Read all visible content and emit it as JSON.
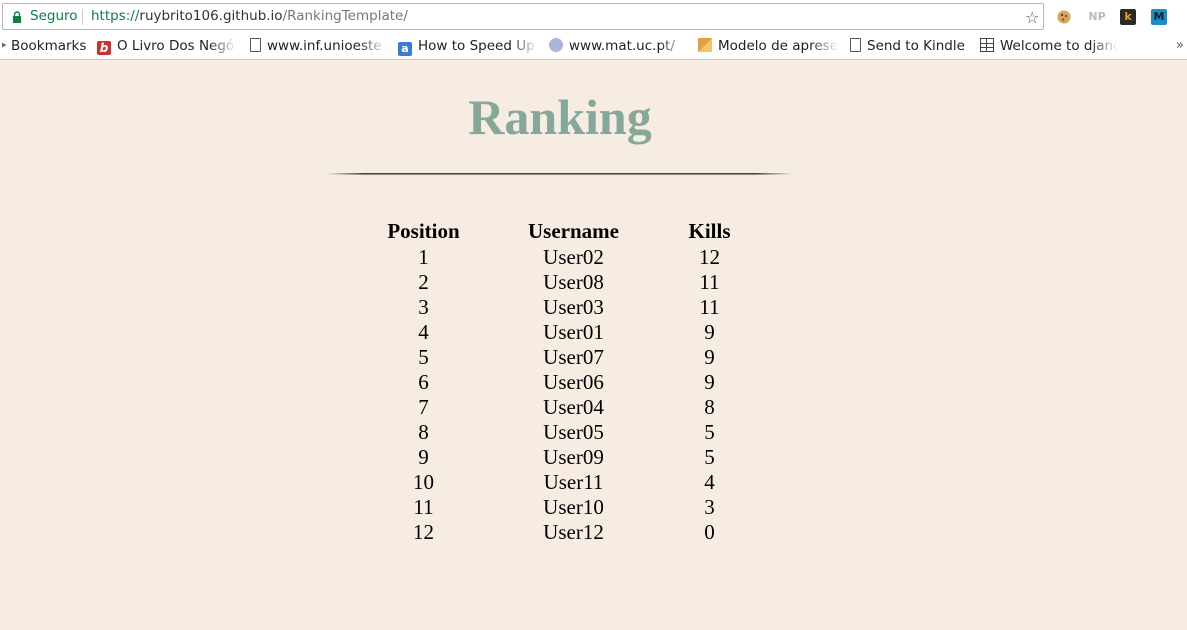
{
  "browser": {
    "secure_label": "Seguro",
    "url_scheme": "https://",
    "url_host": "ruybrito106.github.io",
    "url_path": "/RankingTemplate/",
    "extensions": [
      "cookie-icon",
      "NP",
      "k",
      "M"
    ]
  },
  "bookmarks": [
    {
      "label": "Bookmarks",
      "icon": "bookmarks-icon"
    },
    {
      "label": "O Livro Dos Negó",
      "icon": "b-logo-icon"
    },
    {
      "label": "www.inf.unioeste",
      "icon": "page-icon"
    },
    {
      "label": "How to Speed Up",
      "icon": "a-logo-icon"
    },
    {
      "label": "www.mat.uc.pt/",
      "icon": "globe-icon"
    },
    {
      "label": "Modelo de apresen",
      "icon": "slides-icon"
    },
    {
      "label": "Send to Kindle",
      "icon": "page-icon"
    },
    {
      "label": "Welcome to djang",
      "icon": "grid-icon"
    }
  ],
  "page": {
    "title": "Ranking",
    "columns": [
      "Position",
      "Username",
      "Kills"
    ],
    "rows": [
      [
        "1",
        "User02",
        "12"
      ],
      [
        "2",
        "User08",
        "11"
      ],
      [
        "3",
        "User03",
        "11"
      ],
      [
        "4",
        "User01",
        "9"
      ],
      [
        "5",
        "User07",
        "9"
      ],
      [
        "6",
        "User06",
        "9"
      ],
      [
        "7",
        "User04",
        "8"
      ],
      [
        "8",
        "User05",
        "5"
      ],
      [
        "9",
        "User09",
        "5"
      ],
      [
        "10",
        "User11",
        "4"
      ],
      [
        "11",
        "User10",
        "3"
      ],
      [
        "12",
        "User12",
        "0"
      ]
    ]
  },
  "colors": {
    "background": "#f6ece1",
    "title": "#85a89a",
    "secure": "#0b8043"
  }
}
